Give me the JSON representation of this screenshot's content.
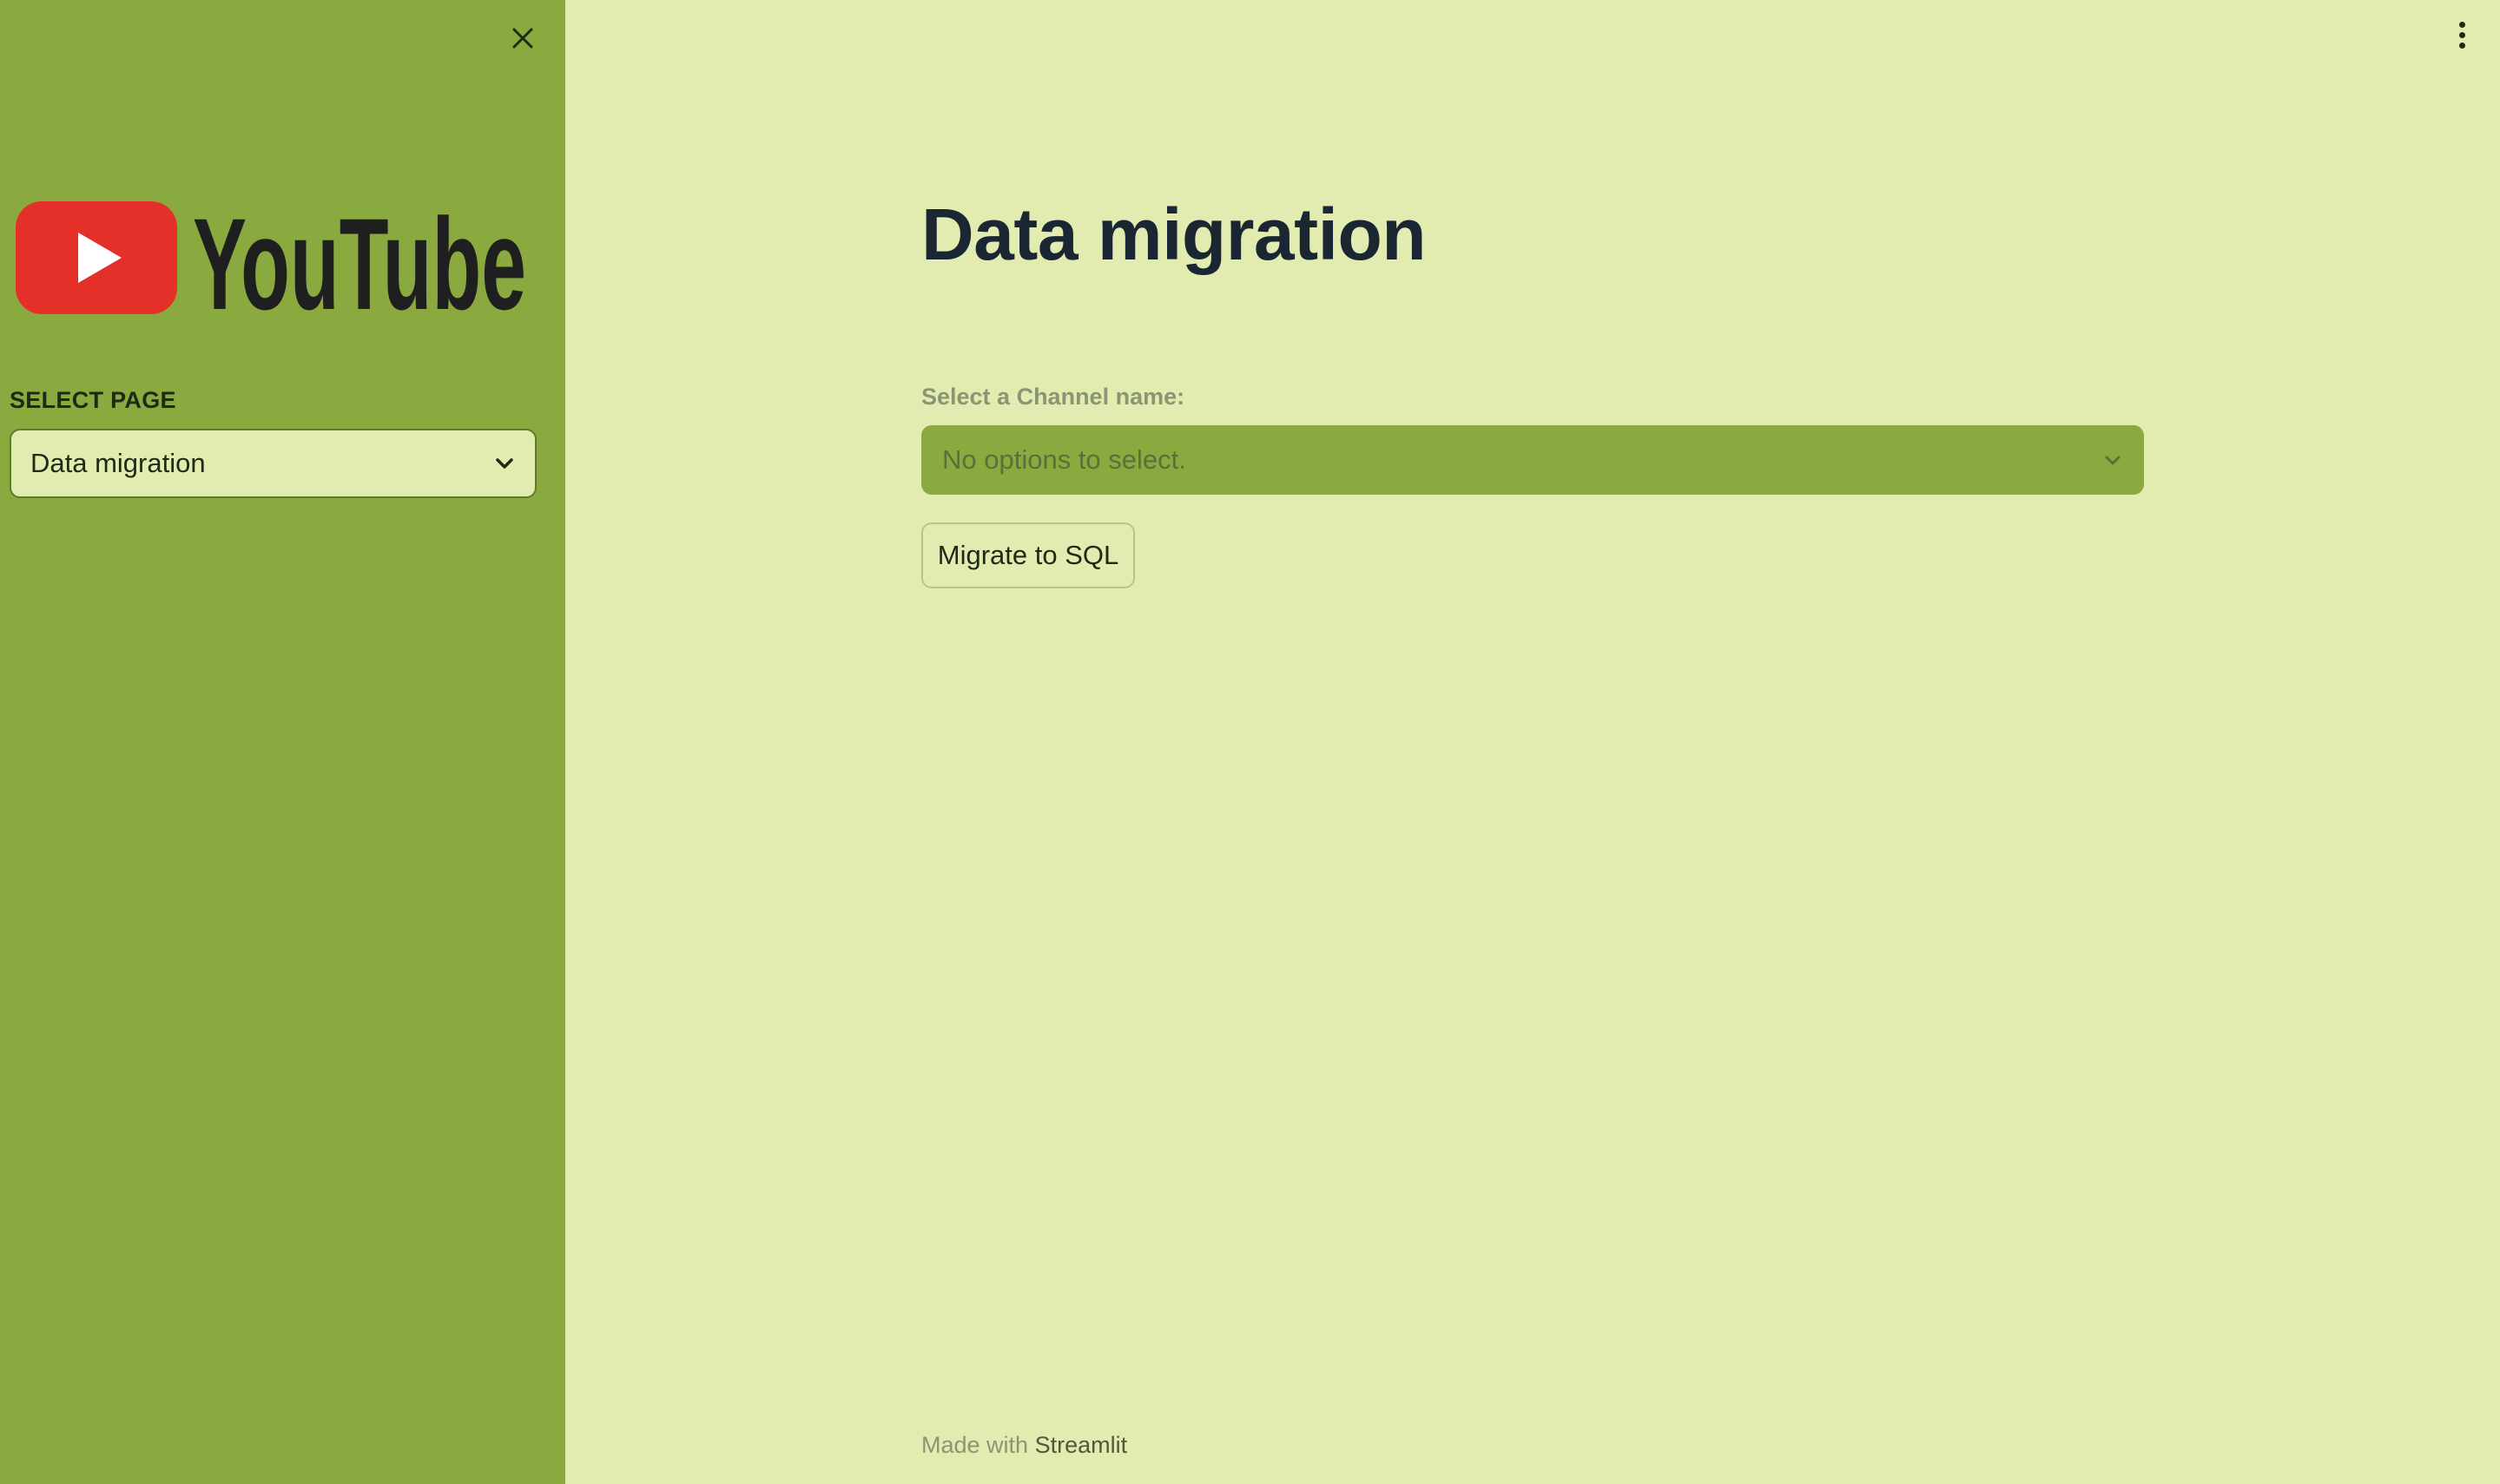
{
  "sidebar": {
    "close_icon": "close-icon",
    "logo": {
      "text": "YouTube",
      "icon": "youtube-play-icon",
      "brand_color": "#e5302a"
    },
    "select_label": "SELECT PAGE",
    "page_select": {
      "value": "Data migration",
      "icon": "chevron-down-icon"
    }
  },
  "header": {
    "menu_icon": "more-vertical-icon"
  },
  "main": {
    "title": "Data migration",
    "channel_label": "Select a Channel name:",
    "channel_select": {
      "placeholder": "No options to select.",
      "icon": "chevron-down-icon"
    },
    "migrate_button": "Migrate to SQL"
  },
  "footer": {
    "prefix": "Made with",
    "brand": "Streamlit"
  },
  "colors": {
    "sidebar_bg": "#8aaa40",
    "main_bg": "#e2ebb0",
    "title": "#1b2633",
    "youtube_red": "#e5302a"
  }
}
